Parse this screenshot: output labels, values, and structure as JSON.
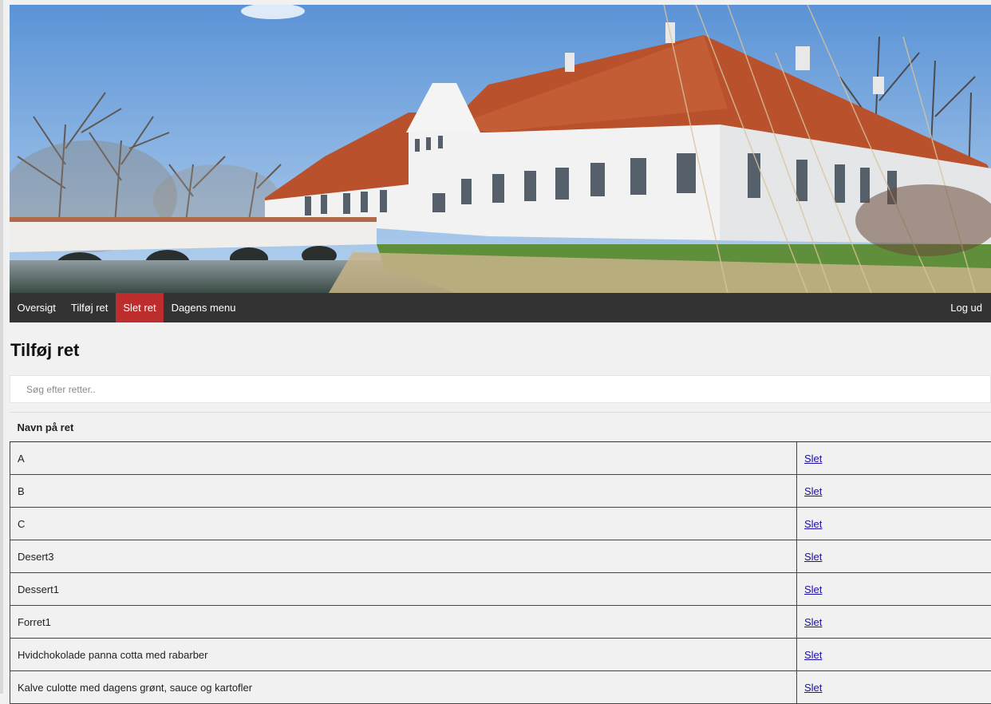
{
  "nav": {
    "items": [
      {
        "label": "Oversigt",
        "active": false
      },
      {
        "label": "Tilføj ret",
        "active": false
      },
      {
        "label": "Slet ret",
        "active": true
      },
      {
        "label": "Dagens menu",
        "active": false
      }
    ],
    "logout": "Log ud"
  },
  "page": {
    "title": "Tilføj ret"
  },
  "search": {
    "placeholder": "Søg efter retter.."
  },
  "table": {
    "header": "Navn på ret",
    "action_label": "Slet",
    "rows": [
      "A",
      "B",
      "C",
      "Desert3",
      "Dessert1",
      "Forret1",
      "Hvidchokolade panna cotta med rabarber",
      "Kalve culotte med dagens grønt, sauce og kartofler"
    ]
  },
  "colors": {
    "navbar": "#333333",
    "active_tab": "#bd2d2d",
    "link": "#1a0dab"
  }
}
